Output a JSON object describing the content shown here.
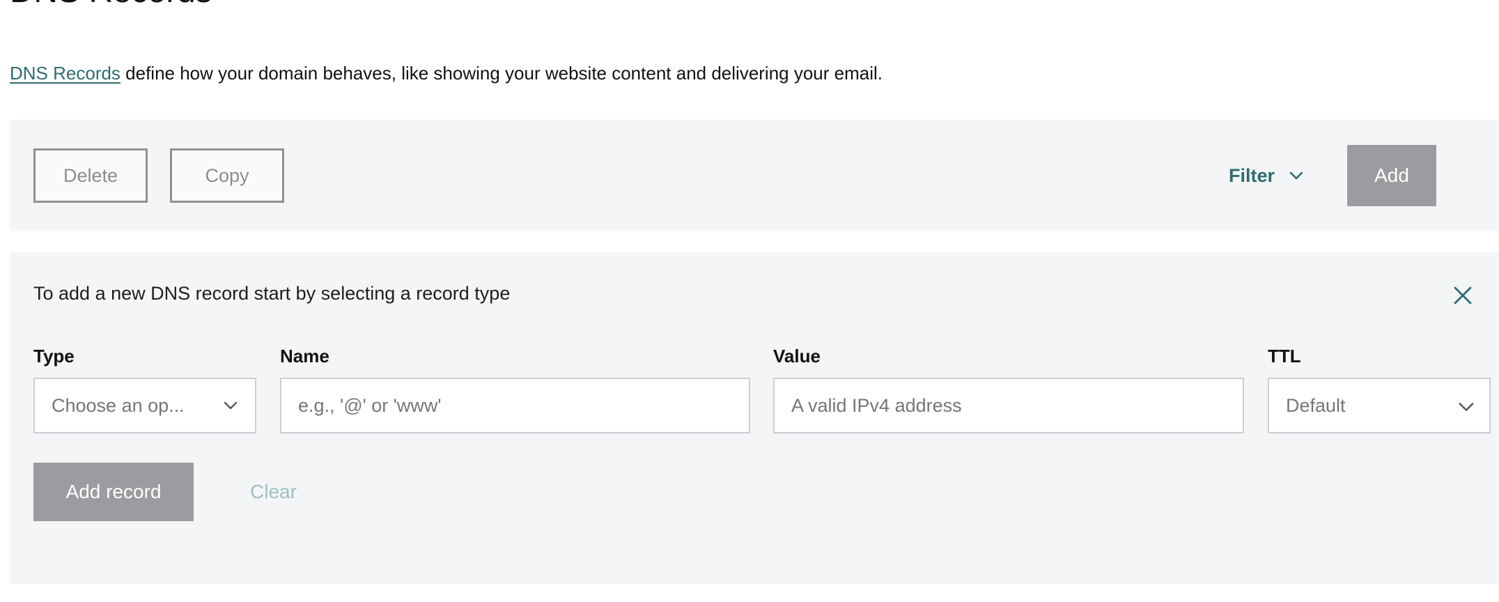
{
  "header": {
    "title": "DNS Records",
    "description_link": "DNS Records",
    "description_rest": " define how your domain behaves, like showing your website content and delivering your email."
  },
  "toolbar": {
    "delete_label": "Delete",
    "copy_label": "Copy",
    "filter_label": "Filter",
    "filter_icon": "chevron-down-icon",
    "add_label": "Add"
  },
  "add_panel": {
    "instruction": "To add a new DNS record start by selecting a record type",
    "close_icon": "close-icon",
    "fields": {
      "type": {
        "label": "Type",
        "value": "Choose an op...",
        "icon": "chevron-down-icon"
      },
      "name": {
        "label": "Name",
        "value": "",
        "placeholder": "e.g., '@' or 'www'"
      },
      "value": {
        "label": "Value",
        "value": "",
        "placeholder": "A valid IPv4 address"
      },
      "ttl": {
        "label": "TTL",
        "value": "Default",
        "icon": "chevron-down-icon"
      }
    },
    "actions": {
      "add_record_label": "Add record",
      "clear_label": "Clear"
    }
  },
  "colors": {
    "accent_teal": "#2e6c70",
    "panel_bg": "#f4f5f7",
    "disabled_gray": "#9a9c9f",
    "muted_teal": "#9cc0c1",
    "border_gray": "#ccd0d4"
  }
}
